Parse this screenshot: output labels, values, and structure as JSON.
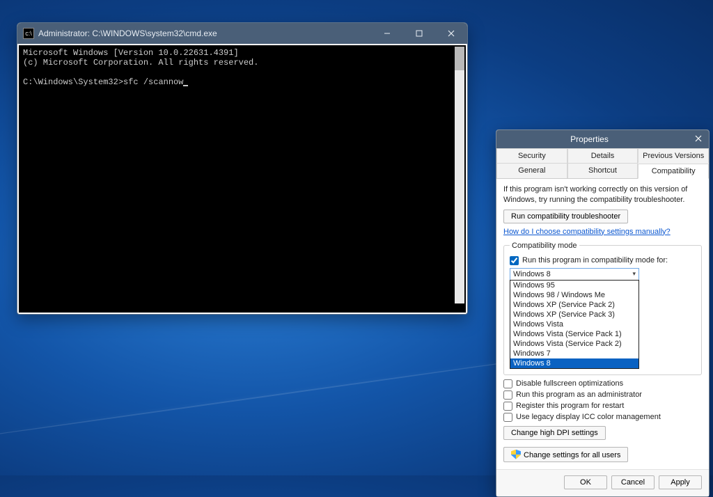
{
  "cmd": {
    "title": "Administrator: C:\\WINDOWS\\system32\\cmd.exe",
    "line1": "Microsoft Windows [Version 10.0.22631.4391]",
    "line2": "(c) Microsoft Corporation. All rights reserved.",
    "prompt": "C:\\Windows\\System32>",
    "typed": "sfc /scannow"
  },
  "props": {
    "title": "Properties",
    "tabs": {
      "security": "Security",
      "details": "Details",
      "previous": "Previous Versions",
      "general": "General",
      "shortcut": "Shortcut",
      "compat": "Compatibility"
    },
    "hint": "If this program isn't working correctly on this version of Windows, try running the compatibility troubleshooter.",
    "trouble_btn": "Run compatibility troubleshooter",
    "help_link": "How do I choose compatibility settings manually?",
    "compat_group": "Compatibility mode",
    "compat_check": "Run this program in compatibility mode for:",
    "compat_selected": "Windows 8",
    "options": {
      "0": "Windows 95",
      "1": "Windows 98 / Windows Me",
      "2": "Windows XP (Service Pack 2)",
      "3": "Windows XP (Service Pack 3)",
      "4": "Windows Vista",
      "5": "Windows Vista (Service Pack 1)",
      "6": "Windows Vista (Service Pack 2)",
      "7": "Windows 7",
      "8": "Windows 8"
    },
    "settings": {
      "disable_fs": "Disable fullscreen optimizations",
      "run_admin": "Run this program as an administrator",
      "register_restart": "Register this program for restart",
      "legacy_icc": "Use legacy display ICC color management",
      "dpi_btn": "Change high DPI settings"
    },
    "all_users_btn": "Change settings for all users",
    "ok": "OK",
    "cancel": "Cancel",
    "apply": "Apply"
  }
}
